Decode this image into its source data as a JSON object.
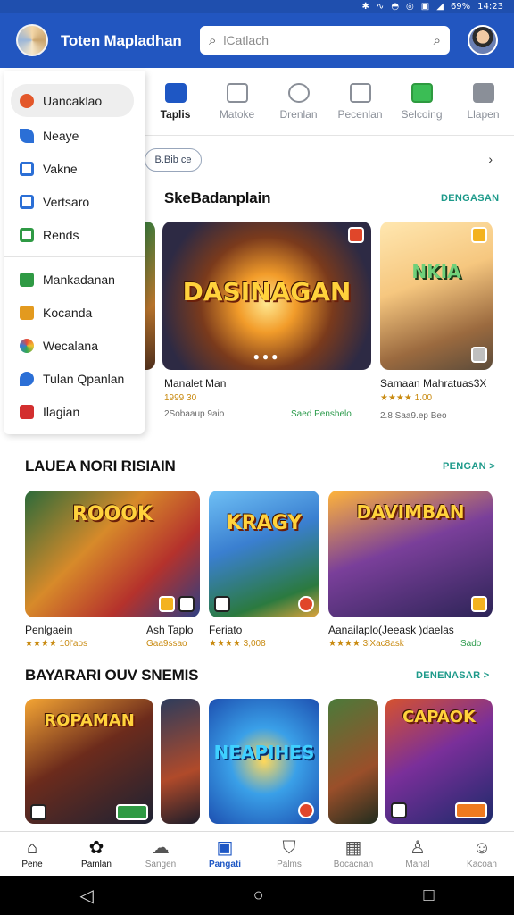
{
  "status": {
    "icons": [
      "bluetooth-icon",
      "vibrate-icon",
      "wifi-icon",
      "sync-icon",
      "image-icon",
      "signal-icon"
    ],
    "battery": "69%",
    "time": "14:23"
  },
  "appbar": {
    "title": "Toten Mapladhan",
    "search_placeholder": "lCatlach"
  },
  "tabs": [
    {
      "label": "Taplis",
      "icon": "card-icon",
      "active": true
    },
    {
      "label": "Matoke",
      "icon": "film-icon"
    },
    {
      "label": "Drenlan",
      "icon": "chat-icon"
    },
    {
      "label": "Pecenlan",
      "icon": "monitor-icon"
    },
    {
      "label": "Selcoing",
      "icon": "message-icon"
    },
    {
      "label": "Llapen",
      "icon": "close-box-icon"
    }
  ],
  "drawer": {
    "items": [
      {
        "label": "Uancaklao",
        "icon": "home-icon",
        "color": "#e3572a",
        "selected": true
      },
      {
        "label": "Neaye",
        "icon": "phone-icon",
        "color": "#2b6fd6"
      },
      {
        "label": "Vakne",
        "icon": "window-icon",
        "color": "#2b6fd6"
      },
      {
        "label": "Vertsaro",
        "icon": "monitor-icon",
        "color": "#2b6fd6"
      },
      {
        "label": "Rends",
        "icon": "bookmark-icon",
        "color": "#2f9a44"
      }
    ],
    "items2": [
      {
        "label": "Mankadanan",
        "icon": "book-icon",
        "color": "#2f9a44"
      },
      {
        "label": "Kocanda",
        "icon": "folder-icon",
        "color": "#e39a1f"
      },
      {
        "label": "Wecalana",
        "icon": "chrome-icon",
        "color": "#3a7ad6"
      },
      {
        "label": "Tulan Qpanlan",
        "icon": "drop-icon",
        "color": "#2b6fd6"
      },
      {
        "label": "Ilagian",
        "icon": "video-icon",
        "color": "#d32f2f"
      }
    ]
  },
  "chip": {
    "label": "B.Bib ce"
  },
  "sections": [
    {
      "title": "SkeBadanplain",
      "more": "DENGASAN",
      "games": [
        {
          "art": "",
          "name": "",
          "rating": "",
          "meta": ""
        },
        {
          "art": "DASINAGAN",
          "name": "Manalet Man",
          "rating": "1999 30",
          "meta": "2Sobaaup 9aio",
          "tag": "Saed Penshelo"
        },
        {
          "art": "NKIA",
          "name": "Samaan Mahratuas3X",
          "rating": "★★★★ 1.00",
          "meta": "2.8 Saa9.ep Beo"
        }
      ]
    },
    {
      "title": "LAUEA NORI RISIAIN",
      "more": "PENGAN >",
      "games": [
        {
          "art": "ROOOK",
          "name": "Penlgaein",
          "rating": "★★★★ 10l'aos",
          "meta": ""
        },
        {
          "art": "",
          "name": "Ash Taplo",
          "rating": "Gaa9ssao",
          "meta": ""
        },
        {
          "art": "KRAGY",
          "name": "Feriato",
          "rating": "★★★★ 3,008",
          "meta": ""
        },
        {
          "art": "DAVIMBAN",
          "name": "Aanailaplo(Jeeask )daelas",
          "rating": "★★★★ 3lXac8ask",
          "meta": "",
          "tag": "Sado"
        }
      ]
    },
    {
      "title": "BAYARARI OUV SNEMIS",
      "more": "DENENASAR >",
      "games": [
        {
          "art": "ROPAMAN",
          "name": ""
        },
        {
          "art": "",
          "name": ""
        },
        {
          "art": "NEAPIHES",
          "name": ""
        },
        {
          "art": "",
          "name": ""
        },
        {
          "art": "CAPAOK",
          "name": ""
        }
      ]
    }
  ],
  "bottomnav": [
    {
      "label": "Pene",
      "icon": "home-icon"
    },
    {
      "label": "Pamlan",
      "icon": "bell-icon"
    },
    {
      "label": "Sangen",
      "icon": "cloud-icon"
    },
    {
      "label": "Pangati",
      "icon": "store-icon",
      "active": true
    },
    {
      "label": "Palms",
      "icon": "shield-icon"
    },
    {
      "label": "Bocacnan",
      "icon": "calendar-icon"
    },
    {
      "label": "Manal",
      "icon": "person-icon"
    },
    {
      "label": "Kacoan",
      "icon": "account-icon"
    }
  ]
}
